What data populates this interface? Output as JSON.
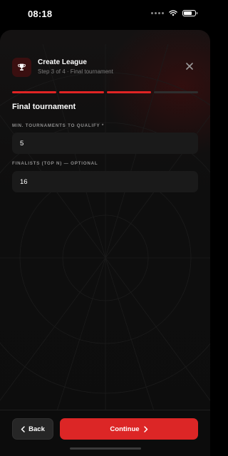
{
  "status_bar": {
    "time": "08:18"
  },
  "header": {
    "title": "Create League",
    "subtitle": "Step 3 of 4 · Final tournament"
  },
  "progress": {
    "total_steps": 4,
    "current_step": 3
  },
  "section": {
    "title": "Final tournament"
  },
  "fields": {
    "min_tournaments": {
      "label": "MIN. TOURNAMENTS TO QUALIFY *",
      "value": "5"
    },
    "finalists": {
      "label": "FINALISTS (TOP N) — OPTIONAL",
      "value": "16"
    }
  },
  "footer": {
    "back_label": "Back",
    "continue_label": "Continue"
  },
  "colors": {
    "accent": "#dc2626",
    "background": "#0d0d0d",
    "field": "#1a1a1a"
  },
  "icons": [
    "trophy-icon",
    "close-icon",
    "chevron-left-icon",
    "chevron-right-icon",
    "wifi-icon",
    "battery-icon"
  ]
}
